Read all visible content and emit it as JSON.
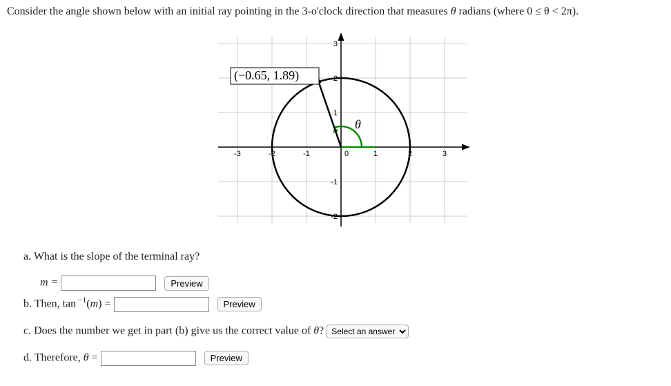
{
  "prompt": {
    "pre": "Consider the angle shown below with an initial ray pointing in the 3-o'clock direction that measures ",
    "theta": "θ",
    "mid": " radians (where ",
    "cond": "0 ≤ θ < 2π",
    "post": ")."
  },
  "graph": {
    "point_label": "(−0.65, 1.89)",
    "theta_label": "θ",
    "ticks_x": [
      "-3",
      "-2",
      "-1",
      "0",
      "1",
      "2",
      "3"
    ],
    "ticks_y": [
      "3",
      "2",
      "1",
      "-1",
      "-2"
    ]
  },
  "a": {
    "text": "a. What is the slope of the terminal ray?",
    "m_eq": "m =",
    "preview": "Preview"
  },
  "b": {
    "pre": "b. Then, tan",
    "sup": " −1",
    "arg": "(m) =",
    "preview": "Preview"
  },
  "c": {
    "text": "c. Does the number we get in part (b) give us the correct value of θ?",
    "select_placeholder": "Select an answer"
  },
  "d": {
    "text": "d. Therefore, θ =",
    "preview": "Preview"
  },
  "chart_data": {
    "type": "scatter",
    "title": "",
    "xlabel": "",
    "ylabel": "",
    "xlim": [
      -3.5,
      3.5
    ],
    "ylim": [
      -2.2,
      3.2
    ],
    "circle": {
      "cx": 0,
      "cy": 0,
      "r": 2
    },
    "initial_ray_endpoint": [
      1,
      0
    ],
    "terminal_point": [
      -0.65,
      1.89
    ],
    "theta_angle_radians_approx": 1.902,
    "grid": true
  }
}
